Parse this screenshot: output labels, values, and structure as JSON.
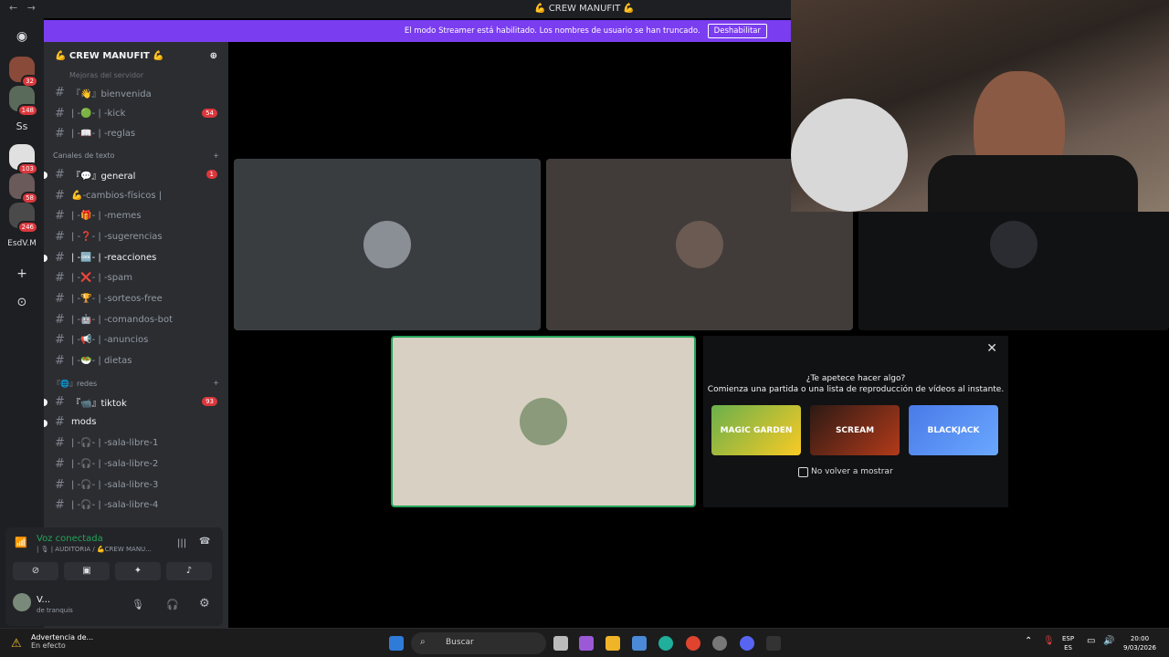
{
  "titlebar": {
    "back": "←",
    "forward": "→",
    "title": "💪 CREW MANUFIT 💪"
  },
  "streamer": {
    "message": "El modo Streamer está habilitado. Los nombres de usuario se han truncado.",
    "button": "Deshabilitar"
  },
  "guilds": {
    "badges": [
      "32",
      "148",
      "103",
      "58",
      "246"
    ],
    "text_items": [
      "Ss",
      "EsdV.M"
    ]
  },
  "server": {
    "name": "💪 CREW MANUFIT 💪",
    "partial_line": "Mejoras del servidor"
  },
  "channels_top": [
    {
      "name": "『👋』bienvenida",
      "mention": ""
    },
    {
      "name": "| -🟢- | -kick",
      "mention": "54"
    },
    {
      "name": "| -📖- | -reglas",
      "mention": ""
    }
  ],
  "category_text": "Canales de texto",
  "channels_text": [
    {
      "name": "『💬』general",
      "mention": "1",
      "unread": true
    },
    {
      "name": "💪-cambios-físicos |",
      "mention": "",
      "unread": false
    },
    {
      "name": "| -🎁- | -memes",
      "mention": "",
      "unread": false
    },
    {
      "name": "| -❓- | -sugerencias",
      "mention": "",
      "unread": false
    },
    {
      "name": "| -🆒- | -reacciones",
      "mention": "",
      "unread": true
    },
    {
      "name": "| -❌- | -spam",
      "mention": "",
      "unread": false
    },
    {
      "name": "| -🏆- | -sorteos-free",
      "mention": "",
      "unread": false
    },
    {
      "name": "| -🤖- | -comandos-bot",
      "mention": "",
      "unread": false
    },
    {
      "name": "| -📢- | -anuncios",
      "mention": "",
      "unread": false
    },
    {
      "name": "| -🥗- | dietas",
      "mention": "",
      "unread": false
    }
  ],
  "category_redes": "『🌐』redes",
  "channels_redes": [
    {
      "name": "『📹』tiktok",
      "mention": "93",
      "unread": true
    },
    {
      "name": "mods",
      "mention": "",
      "unread": true
    },
    {
      "name": "| -🎧- | -sala-libre-1",
      "mention": "",
      "unread": false
    },
    {
      "name": "| -🎧- | -sala-libre-2",
      "mention": "",
      "unread": false
    },
    {
      "name": "| -🎧- | -sala-libre-3",
      "mention": "",
      "unread": false
    },
    {
      "name": "| -🎧- | -sala-libre-4",
      "mention": "",
      "unread": false
    }
  ],
  "voice": {
    "status": "Voz conectada",
    "channel": "| 🎙 | AUDITORIA / 💪CREW MANU..."
  },
  "user": {
    "name": "V...",
    "status": "de tranquis"
  },
  "activity": {
    "question": "¿Te apetece hacer algo?",
    "subtitle": "Comienza una partida o una lista de reproducción de vídeos al instante.",
    "games": [
      "MAGIC GARDEN",
      "SCREAM",
      "BLACKJACK"
    ],
    "dont_show": "No volver a mostrar"
  },
  "taskbar": {
    "warning_title": "Advertencia de...",
    "warning_sub": "En efecto",
    "search": "Buscar",
    "lang": "ESP",
    "lang_sub": "ES",
    "time": "20:00",
    "date": "9/03/2026"
  },
  "colors": {
    "accent": "#7b3df0",
    "mention": "#da373c",
    "voice_green": "#23a55a"
  }
}
